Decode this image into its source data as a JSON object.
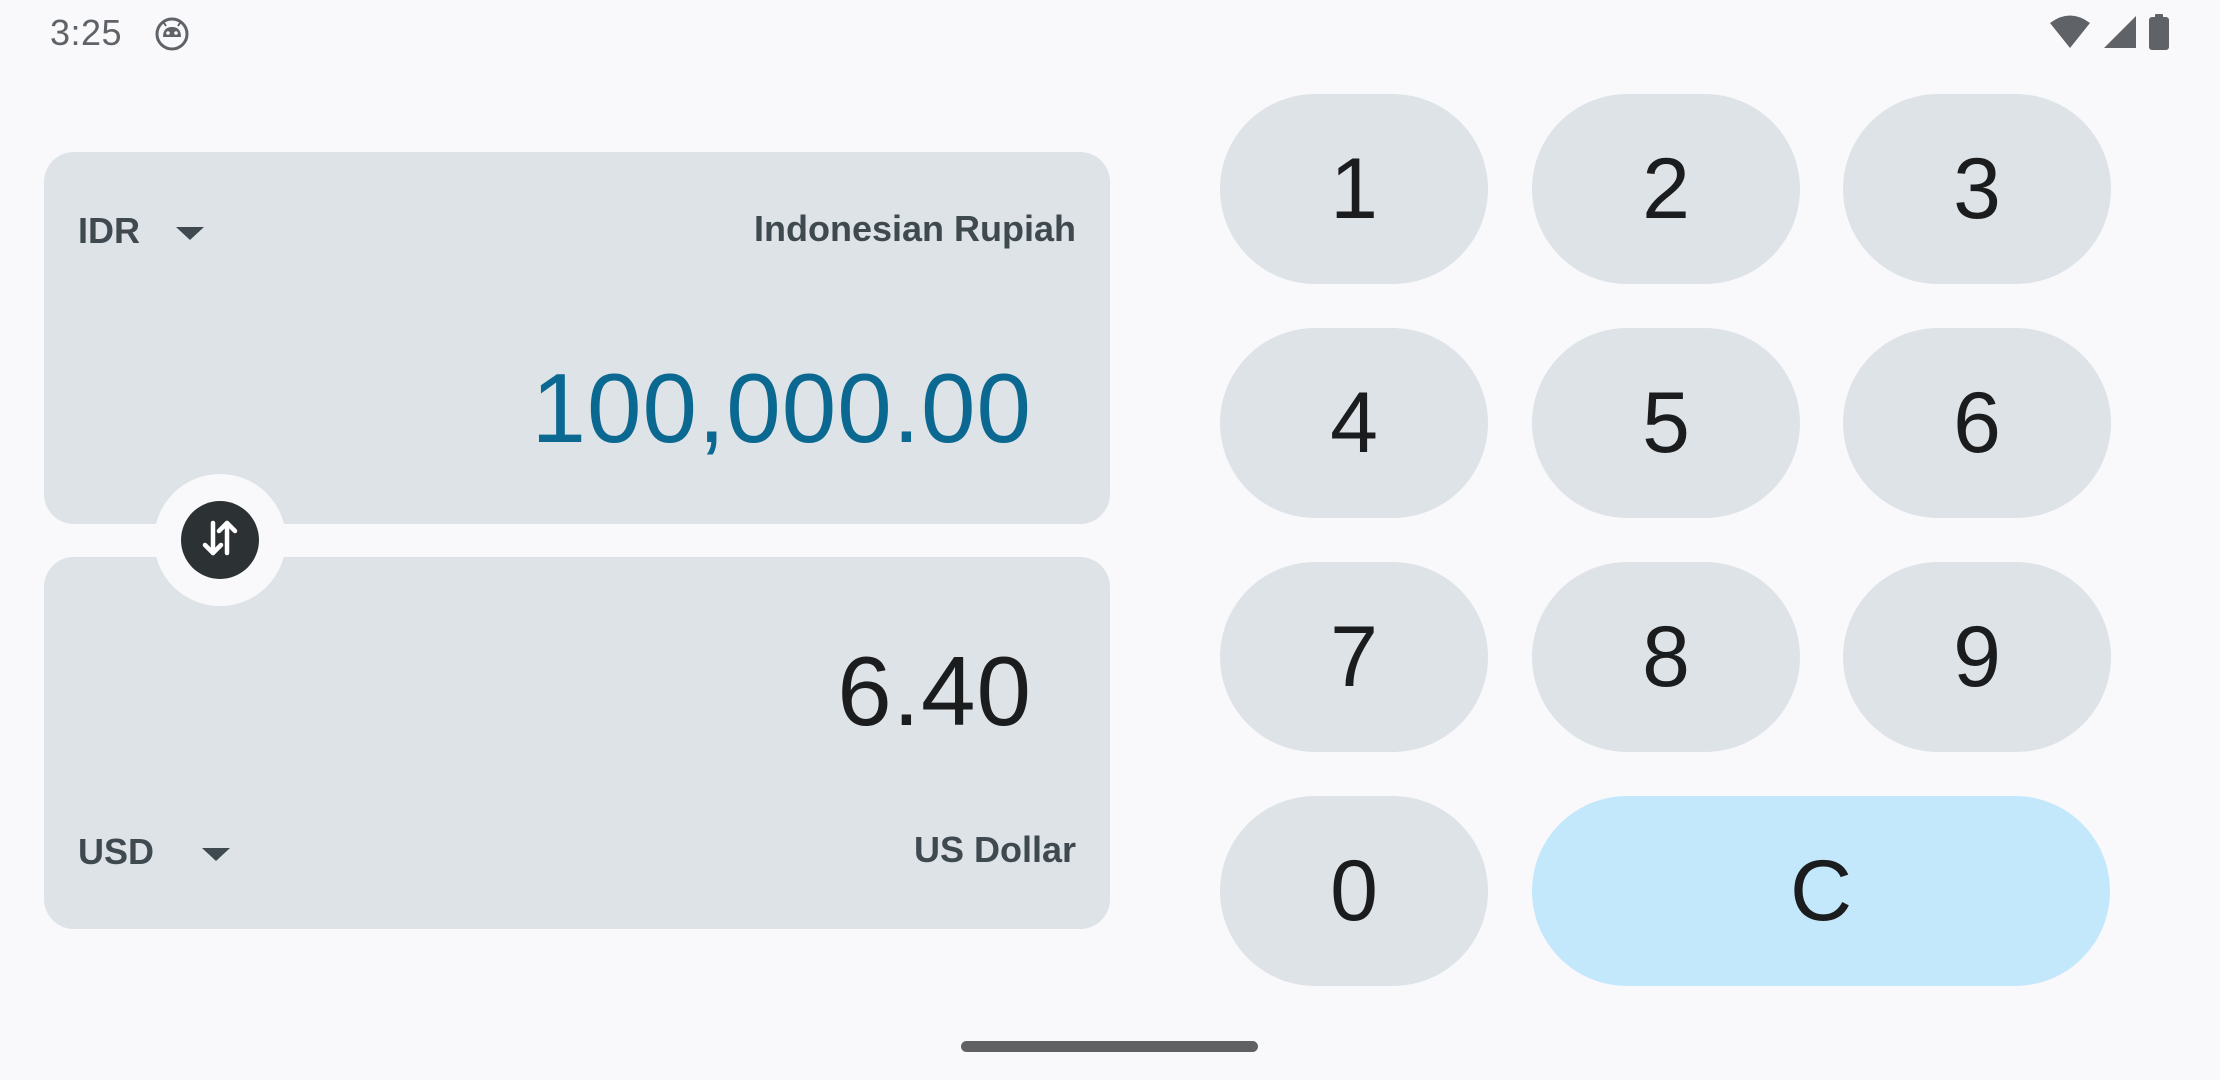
{
  "status_bar": {
    "time": "3:25",
    "app_icon": "android-face-icon",
    "icons": [
      "wifi-icon",
      "cell-signal-icon",
      "battery-icon"
    ]
  },
  "converter": {
    "from": {
      "code": "IDR",
      "name": "Indonesian Rupiah",
      "amount": "100,000.00"
    },
    "to": {
      "code": "USD",
      "name": "US Dollar",
      "amount": "6.40"
    },
    "swap_icon": "swap-vertical-icon"
  },
  "keypad": {
    "keys": [
      "1",
      "2",
      "3",
      "4",
      "5",
      "6",
      "7",
      "8",
      "9",
      "0"
    ],
    "clear": "C"
  },
  "colors": {
    "background": "#f9f9fc",
    "card": "#dee3e8",
    "accent_amount": "#0b6890",
    "clear_key": "#c3e7fb",
    "swap_button": "#2c3134"
  }
}
